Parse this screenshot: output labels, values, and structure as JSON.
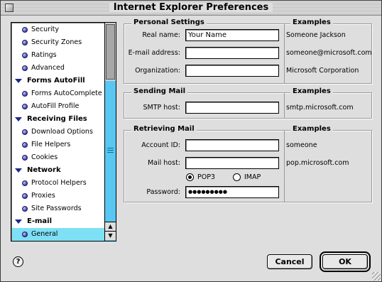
{
  "window": {
    "title": "Internet Explorer Preferences"
  },
  "sidebar": {
    "items": [
      {
        "type": "item",
        "label": "Security"
      },
      {
        "type": "item",
        "label": "Security Zones"
      },
      {
        "type": "item",
        "label": "Ratings"
      },
      {
        "type": "item",
        "label": "Advanced"
      },
      {
        "type": "group",
        "label": "Forms AutoFill"
      },
      {
        "type": "item",
        "label": "Forms AutoComplete"
      },
      {
        "type": "item",
        "label": "AutoFill Profile"
      },
      {
        "type": "group",
        "label": "Receiving Files"
      },
      {
        "type": "item",
        "label": "Download Options"
      },
      {
        "type": "item",
        "label": "File Helpers"
      },
      {
        "type": "item",
        "label": "Cookies"
      },
      {
        "type": "group",
        "label": "Network"
      },
      {
        "type": "item",
        "label": "Protocol Helpers"
      },
      {
        "type": "item",
        "label": "Proxies"
      },
      {
        "type": "item",
        "label": "Site Passwords"
      },
      {
        "type": "group",
        "label": "E-mail"
      },
      {
        "type": "item",
        "label": "General",
        "selected": true
      }
    ]
  },
  "personal": {
    "title": "Personal Settings",
    "examples_title": "Examples",
    "real_name_label": "Real name:",
    "real_name_value": "Your Name",
    "real_name_example": "Someone Jackson",
    "email_label": "E-mail address:",
    "email_value": "",
    "email_example": "someone@microsoft.com",
    "org_label": "Organization:",
    "org_value": "",
    "org_example": "Microsoft Corporation"
  },
  "sending": {
    "title": "Sending Mail",
    "examples_title": "Examples",
    "smtp_label": "SMTP host:",
    "smtp_value": "",
    "smtp_example": "smtp.microsoft.com"
  },
  "retrieving": {
    "title": "Retrieving Mail",
    "examples_title": "Examples",
    "account_label": "Account ID:",
    "account_value": "",
    "account_example": "someone",
    "mailhost_label": "Mail host:",
    "mailhost_value": "",
    "mailhost_example": "pop.microsoft.com",
    "protocol_options": [
      "POP3",
      "IMAP"
    ],
    "protocol_selected": "POP3",
    "password_label": "Password:",
    "password_value": "●●●●●●●●●"
  },
  "buttons": {
    "help": "?",
    "cancel": "Cancel",
    "ok": "OK"
  }
}
